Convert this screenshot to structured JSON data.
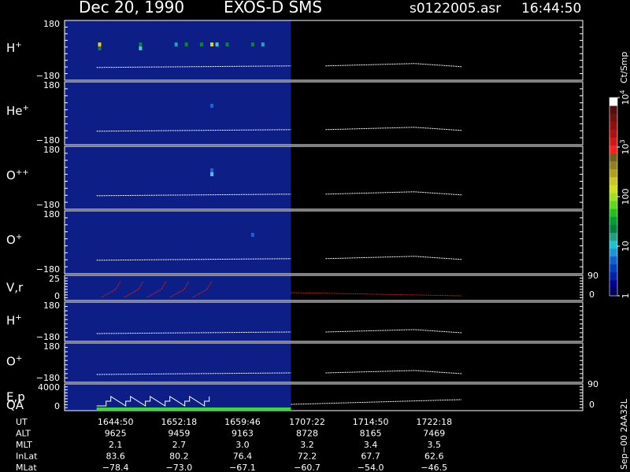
{
  "header": {
    "date": "Dec 20, 1990",
    "instrument": "EXOS-D SMS",
    "file": "s0122005.asr",
    "time": "16:44:50"
  },
  "colors": {
    "background": "#000000",
    "data_window": "#0d1f86",
    "axis": "#ffffff",
    "velocity_trace": "#d02020",
    "qa_bar": "#33dd33"
  },
  "chart_data": {
    "type": "heatmap",
    "panels": [
      {
        "label": "H",
        "sup": "+",
        "ymax": "180",
        "ymin": "−180",
        "blocks": [
          {
            "t": 16.75,
            "c": "#e0d020"
          },
          {
            "t": 16.75,
            "c": "#108040"
          },
          {
            "t": 16.83,
            "c": "#108040"
          },
          {
            "t": 16.83,
            "c": "#40c8d8"
          },
          {
            "t": 16.9,
            "c": "#20a0c0"
          },
          {
            "t": 16.92,
            "c": "#108040"
          },
          {
            "t": 16.95,
            "c": "#108040"
          },
          {
            "t": 16.97,
            "c": "#e0d020"
          },
          {
            "t": 16.98,
            "c": "#40c8d8"
          },
          {
            "t": 17.0,
            "c": "#108040"
          },
          {
            "t": 17.05,
            "c": "#108040"
          },
          {
            "t": 17.07,
            "c": "#20a0c0"
          }
        ]
      },
      {
        "label": "He",
        "sup": "+",
        "ymax": "180",
        "ymin": "−180",
        "blocks": [
          {
            "t": 16.97,
            "c": "#2060d0"
          }
        ]
      },
      {
        "label": "O",
        "sup": "++",
        "ymax": "180",
        "ymin": "−180",
        "blocks": [
          {
            "t": 16.97,
            "c": "#2060d0"
          },
          {
            "t": 16.97,
            "c": "#40c8d8"
          }
        ]
      },
      {
        "label": "O",
        "sup": "+",
        "ymax": "180",
        "ymin": "−180",
        "blocks": [
          {
            "t": 17.05,
            "c": "#2060d0"
          }
        ]
      },
      {
        "label": "V,r",
        "sup": "",
        "ymax": "25",
        "ymin": "0",
        "right_top": "90",
        "right_bottom": "0",
        "trace": "velocity"
      },
      {
        "label": "H",
        "sup": "+",
        "ymax": "180",
        "ymin": "−180"
      },
      {
        "label": "O",
        "sup": "+",
        "ymax": "180",
        "ymin": "−180"
      },
      {
        "label": "E,p",
        "label2": "QA",
        "sup": "",
        "ymax": "4000",
        "ymin": "0",
        "right_top": "90",
        "right_bottom": "0",
        "trace": "energy"
      }
    ],
    "data_start_hours": 16.7472,
    "data_window_end_hours": 17.1281,
    "data_end_hours": 17.4625,
    "colorbar": {
      "title": "Ct/Smp",
      "ticks": [
        {
          "value": 1,
          "label": "1"
        },
        {
          "value": 10,
          "label": "10"
        },
        {
          "value": 100,
          "label": "100"
        },
        {
          "value": 1000,
          "label": "10",
          "sup": "3"
        },
        {
          "value": 10000,
          "label": "10",
          "sup": "4"
        }
      ],
      "colors": [
        "#000060",
        "#000090",
        "#0020b0",
        "#0040c0",
        "#1060d0",
        "#1898d8",
        "#20c0d0",
        "#20a080",
        "#008040",
        "#00a030",
        "#20c020",
        "#60d820",
        "#a0e020",
        "#d0e020",
        "#c8c820",
        "#b0a020",
        "#908020",
        "#706018",
        "#ff2020",
        "#d01818",
        "#b01010",
        "#901010",
        "#701010",
        "#501010",
        "#ffffff"
      ]
    },
    "x_ticks": [
      {
        "ut": "1644:50",
        "alt": "9625",
        "mlt": "2.1",
        "inlat": "83.6",
        "mlat": "−78.4",
        "hours": 16.7472
      },
      {
        "ut": "1652:18",
        "alt": "9459",
        "mlt": "2.7",
        "inlat": "80.2",
        "mlat": "−73.0",
        "hours": 16.8717
      },
      {
        "ut": "1659:46",
        "alt": "9163",
        "mlt": "3.0",
        "inlat": "76.4",
        "mlat": "−67.1",
        "hours": 16.9961
      },
      {
        "ut": "1707:22",
        "alt": "8728",
        "mlt": "3.2",
        "inlat": "72.2",
        "mlat": "−60.7",
        "hours": 17.1228
      },
      {
        "ut": "1714:50",
        "alt": "8165",
        "mlt": "3.4",
        "inlat": "67.7",
        "mlat": "−54.0",
        "hours": 17.2472
      },
      {
        "ut": "1722:18",
        "alt": "7469",
        "mlt": "3.5",
        "inlat": "62.6",
        "mlat": "−46.5",
        "hours": 17.3717
      }
    ],
    "x_axis_rows": [
      "UT",
      "ALT",
      "MLT",
      "InLat",
      "MLat"
    ],
    "x_range_hours": [
      16.6844,
      17.7
    ]
  },
  "footer": {
    "orbit_stamp": "Sep−00  2AA32L"
  }
}
